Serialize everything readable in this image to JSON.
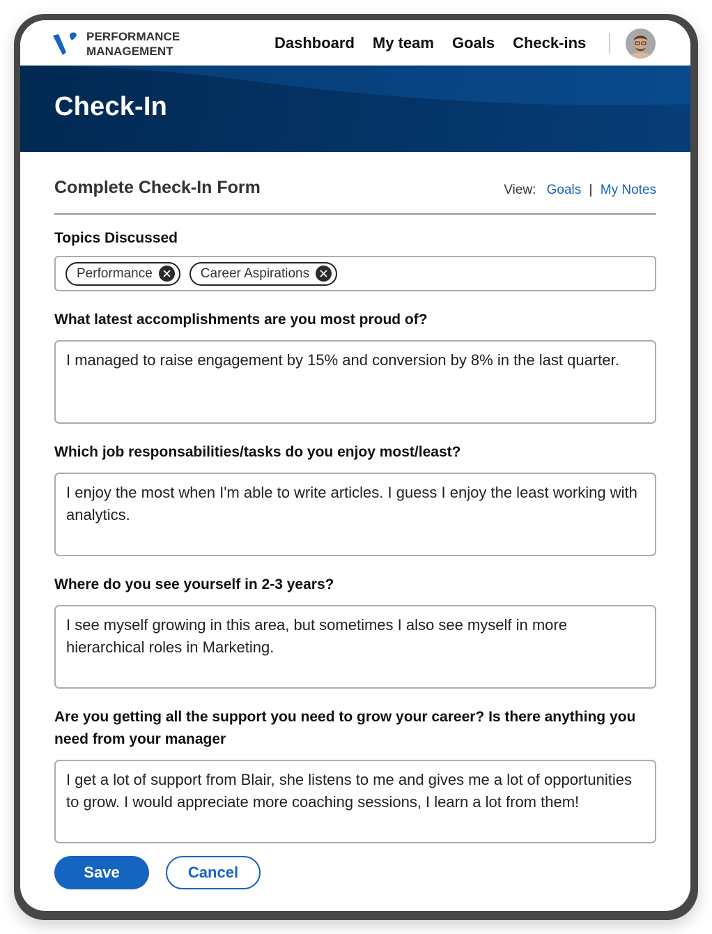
{
  "app": {
    "brand_line1": "PERFORMANCE",
    "brand_line2": "MANAGEMENT",
    "logo_icon": "v-check-logo",
    "accent_color": "#1565c0",
    "hero_color": "#032a55"
  },
  "nav": {
    "items": [
      {
        "label": "Dashboard"
      },
      {
        "label": "My team"
      },
      {
        "label": "Goals"
      },
      {
        "label": "Check-ins"
      }
    ],
    "avatar_icon": "user-avatar"
  },
  "hero": {
    "title": "Check-In"
  },
  "form": {
    "title": "Complete Check-In Form",
    "view_label": "View:",
    "view_links": [
      {
        "label": "Goals"
      },
      {
        "label": "My Notes"
      }
    ],
    "view_separator": "|",
    "topics_label": "Topics Discussed",
    "topics": [
      {
        "label": "Performance",
        "remove_icon": "close-circle-icon"
      },
      {
        "label": "Career Aspirations",
        "remove_icon": "close-circle-icon"
      }
    ],
    "questions": [
      {
        "label": "What latest accomplishments are you most proud of?",
        "answer": "I managed to raise engagement by 15% and conversion by 8% in the last quarter."
      },
      {
        "label": "Which job responsabilities/tasks do you enjoy most/least?",
        "answer": "I enjoy the most when I'm able to write articles. I guess I enjoy the least working with analytics."
      },
      {
        "label": "Where do you see yourself in 2-3 years?",
        "answer": "I see myself growing in this area, but sometimes I also see myself in more hierarchical roles in Marketing."
      },
      {
        "label": "Are you getting all the support you need to grow your career? Is there anything you need from your manager",
        "answer": "I get a lot of support from Blair, she listens to me and gives me a lot of opportunities to grow. I would appreciate more coaching sessions, I learn a lot from them!"
      }
    ],
    "save_label": "Save",
    "cancel_label": "Cancel"
  }
}
